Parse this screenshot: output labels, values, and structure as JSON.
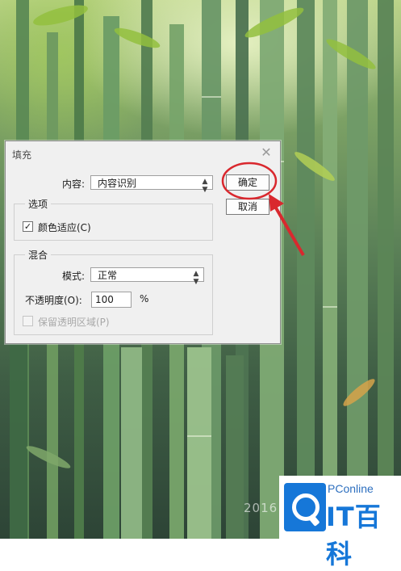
{
  "dialog": {
    "title": "填充",
    "close_icon": "close-icon",
    "content_label": "内容:",
    "content_value": "内容识别",
    "ok_label": "确定",
    "cancel_label": "取消",
    "options": {
      "legend": "选项",
      "color_adapt_label": "颜色适应(C)",
      "color_adapt_checked": true,
      "checkmark": "✓"
    },
    "blend": {
      "legend": "混合",
      "mode_label": "模式:",
      "mode_value": "正常",
      "opacity_label": "不透明度(O):",
      "opacity_value": "100",
      "opacity_unit": "%",
      "preserve_label": "保留透明区域(P)",
      "preserve_checked": false
    },
    "dropdown_arrow": "▲▼"
  },
  "annotation": {
    "color": "#d9282e"
  },
  "watermark": {
    "year": "2016",
    "brand_small": "PConline",
    "brand_big": "IT百科",
    "brand_color": "#1677d8"
  }
}
